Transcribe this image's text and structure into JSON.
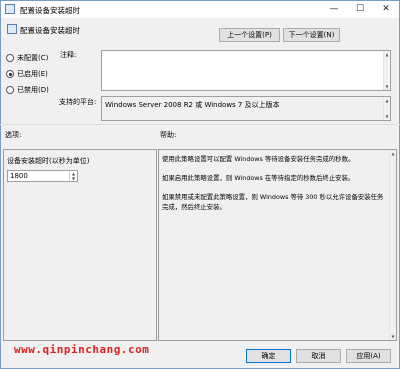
{
  "window": {
    "title": "配置设备安装超时"
  },
  "header": {
    "title": "配置设备安装超时"
  },
  "nav": {
    "prev_label": "上一个设置(P)",
    "next_label": "下一个设置(N)"
  },
  "state": {
    "options": [
      {
        "label": "未配置(C)",
        "selected": false
      },
      {
        "label": "已启用(E)",
        "selected": true
      },
      {
        "label": "已禁用(D)",
        "selected": false
      }
    ]
  },
  "comment": {
    "label": "注释:",
    "value": ""
  },
  "supported": {
    "label": "支持的平台:",
    "value": "Windows Server 2008 R2 或 Windows 7 及以上版本"
  },
  "options_section": {
    "label": "选项:",
    "timeout_label": "设备安装超时(以秒为单位)",
    "timeout_value": "1800"
  },
  "help": {
    "label": "帮助:",
    "paragraphs": [
      "使用此策略设置可以配置 Windows 等待设备安装任务完成的秒数。",
      "如果启用此策略设置，则 Windows 在等待指定的秒数后终止安装。",
      "如果禁用或未配置此策略设置，则 Windows 等待 300 秒以允许设备安装任务完成，然后终止安装。"
    ]
  },
  "buttons": {
    "ok": "确定",
    "cancel": "取消",
    "apply": "应用(A)"
  },
  "watermark": "www.qinpinchang.com"
}
